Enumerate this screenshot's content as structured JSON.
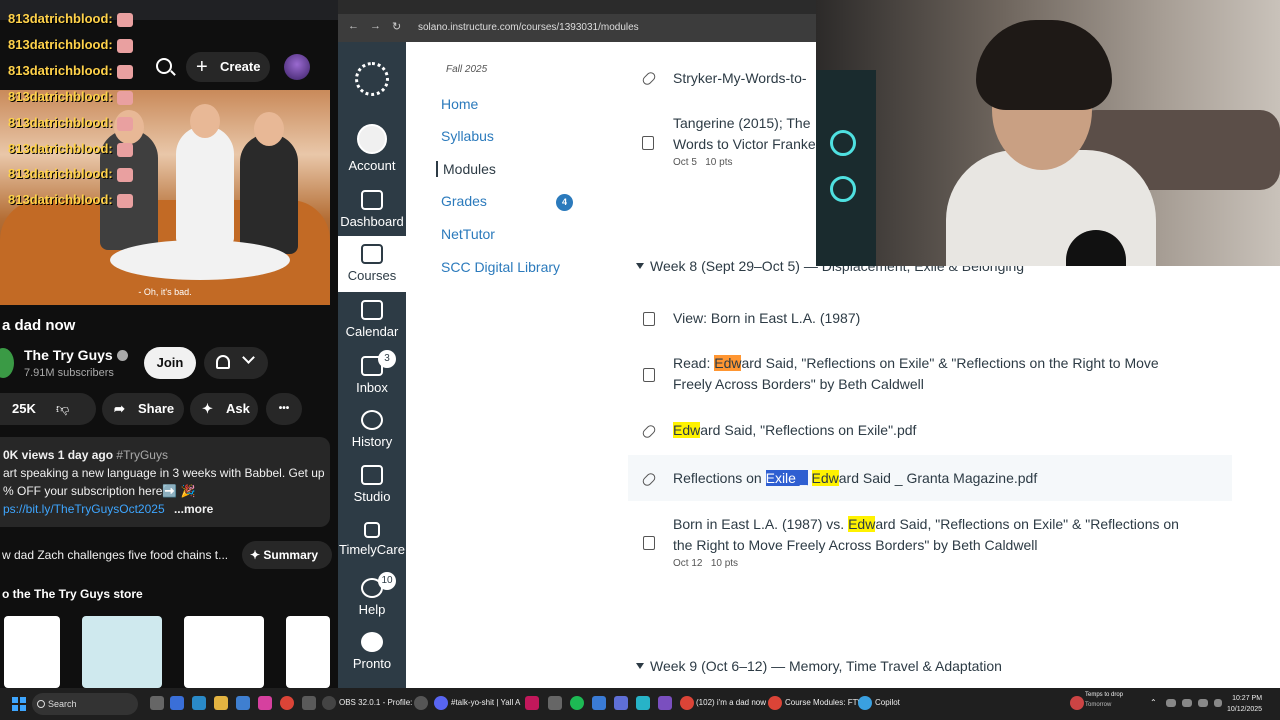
{
  "youtube": {
    "create_label": "Create",
    "chat_user": "813datrichblood:",
    "caption": "- Oh, it's bad.",
    "video_title": "a dad now",
    "channel_name": "The Try Guys",
    "subscribers": "7.91M subscribers",
    "join_label": "Join",
    "likes": "25K",
    "share_label": "Share",
    "ask_label": "Ask",
    "more_dots": "•••",
    "desc_stats": "0K views  1 day ago",
    "desc_hashtag": "#TryGuys",
    "desc_line1": "art speaking a new language in 3 weeks with Babbel. Get up",
    "desc_line2": "% OFF your subscription here➡️ 🎉",
    "desc_link": "ps://bit.ly/TheTryGuysOct2025",
    "desc_more": "...more",
    "next_title": "w dad Zach challenges five food chains t...",
    "summary_label": "✦ Summary",
    "store_title": "o the The Try Guys store"
  },
  "browser": {
    "url": "solano.instructure.com/courses/1393031/modules"
  },
  "global_nav": {
    "items": [
      {
        "label": "Account"
      },
      {
        "label": "Dashboard"
      },
      {
        "label": "Courses"
      },
      {
        "label": "Calendar"
      },
      {
        "label": "Inbox",
        "badge": "3"
      },
      {
        "label": "History"
      },
      {
        "label": "Studio"
      },
      {
        "label": "TimelyCare"
      },
      {
        "label": "Help",
        "badge": "10"
      },
      {
        "label": "Pronto"
      }
    ]
  },
  "course_nav": {
    "term": "Fall 2025",
    "items": [
      "Home",
      "Syllabus",
      "Modules",
      "Grades",
      "NetTutor",
      "SCC Digital Library"
    ],
    "grades_badge": "4"
  },
  "modules": {
    "top_items": [
      {
        "title": "Stryker-My-Words-to-",
        "type": "attachment"
      },
      {
        "title_l1": "Tangerine (2015); The",
        "title_l2": "Words to Victor Franke",
        "meta_date": "Oct 5",
        "meta_pts": "10 pts",
        "type": "assignment"
      }
    ],
    "week8": {
      "title": "Week 8 (Sept 29–Oct 5) — Displacement, Exile & Belonging",
      "items": [
        {
          "title": "View: Born in East L.A. (1987)"
        },
        {
          "pre": "Read: ",
          "hl": "Edw",
          "rest_l1": "ard Said, \"Reflections on Exile\" & \"Reflections on the Right to Move",
          "l2": "Freely Across Borders\" by Beth Caldwell"
        },
        {
          "hl": "Edw",
          "rest": "ard Said, \"Reflections on Exile\".pdf"
        },
        {
          "pre": "Reflections on ",
          "sel": "Exile _",
          "hl": "Edw",
          "rest": "ard Said _ Granta Magazine.pdf"
        },
        {
          "pre": "Born in East L.A. (1987) vs. ",
          "hl": "Edw",
          "rest_l1": "ard Said, \"Reflections on Exile\" & \"Reflections on",
          "l2": "the Right to Move Freely Across Borders\" by Beth Caldwell",
          "meta_date": "Oct 12",
          "meta_pts": "10 pts"
        }
      ]
    },
    "week9": {
      "title": "Week 9 (Oct 6–12) — Memory, Time Travel & Adaptation"
    }
  },
  "taskbar": {
    "search_placeholder": "Search",
    "obs_label": "OBS 32.0.1 - Profile:",
    "discord_label": "#talk-yo-shit | Yall A",
    "yt_label": "(102) i'm a dad now",
    "canvas_label": "Course Modules: FT\\",
    "copilot_label": "Copilot",
    "weather_l1": "Temps to drop",
    "weather_l2": "Tomorrow",
    "time": "10:27 PM",
    "date": "10/12/2025"
  }
}
